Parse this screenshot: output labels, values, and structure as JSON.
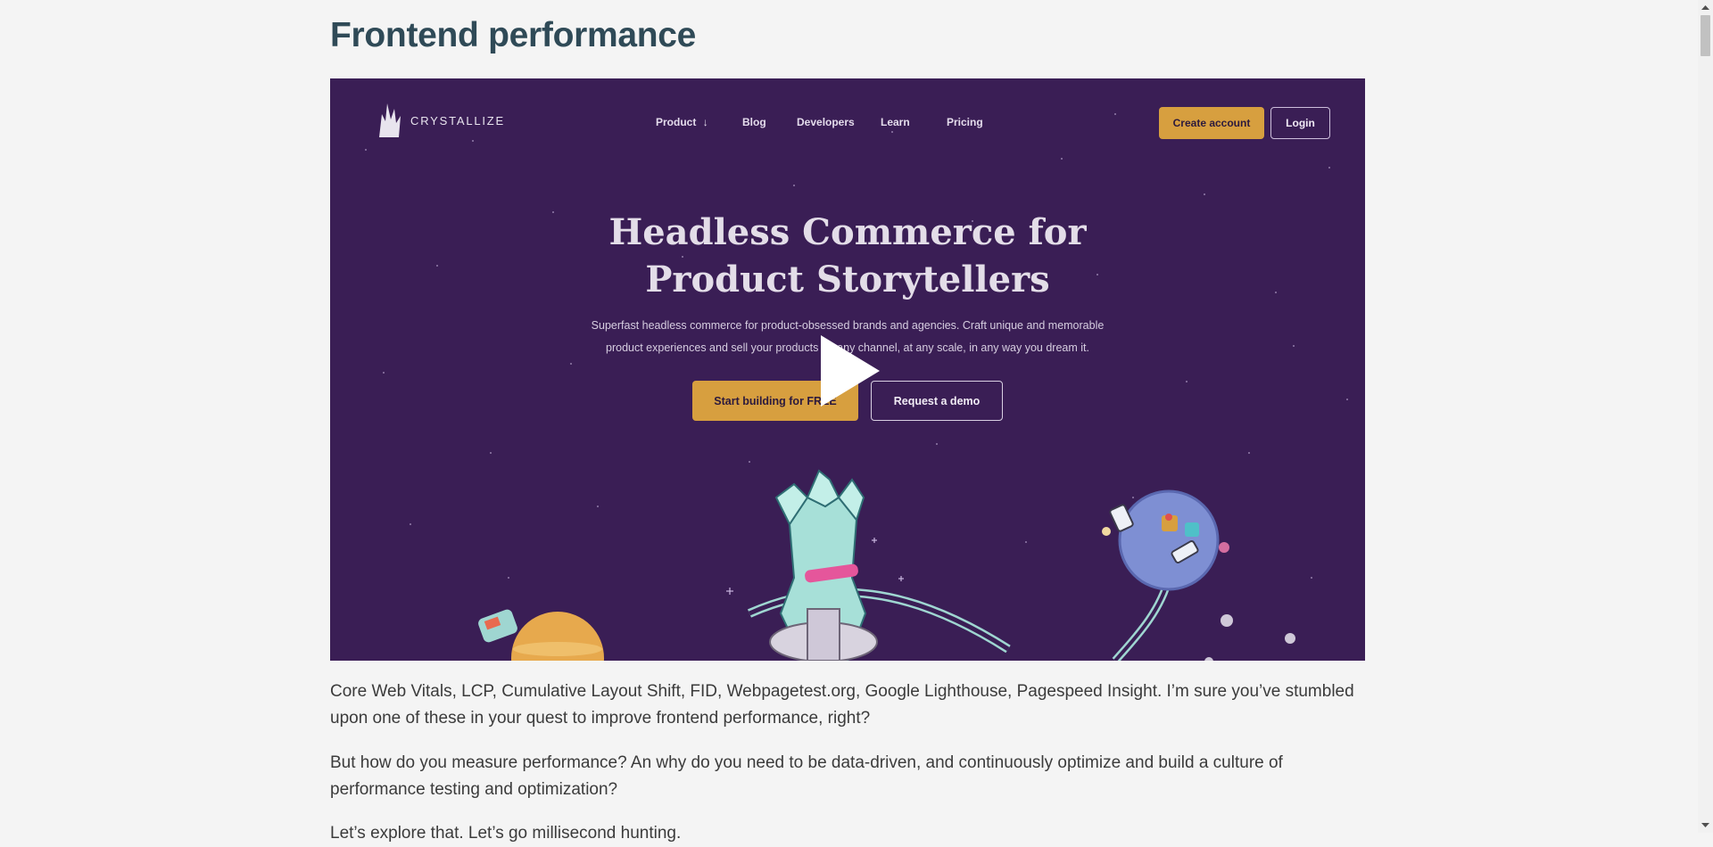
{
  "page": {
    "title": "Frontend performance"
  },
  "video": {
    "logo_text": "CRYSTALLIZE",
    "nav": [
      {
        "label": "Product",
        "has_dropdown": true
      },
      {
        "label": "Blog"
      },
      {
        "label": "Developers"
      },
      {
        "label": "Learn"
      },
      {
        "label": "Pricing"
      }
    ],
    "create_account": "Create account",
    "login": "Login",
    "headline_line1": "Headless Commerce for",
    "headline_line2": "Product Storytellers",
    "sub_line1": "Superfast headless commerce for product-obsessed brands and agencies. Craft unique and memorable",
    "sub_line2": "product experiences and sell your products on any channel, at any scale, in any way you dream it.",
    "cta_primary": "Start building for FREE",
    "cta_secondary": "Request a demo",
    "play_icon": "play-icon",
    "colors": {
      "background": "#3a1e55",
      "accent": "#d79f3f"
    }
  },
  "article": {
    "paragraphs": [
      "Core Web Vitals, LCP, Cumulative Layout Shift, FID, Webpagetest.org, Google Lighthouse, Pagespeed Insight. I’m sure you’ve stumbled upon one of these in your quest to improve frontend performance, right?",
      "But how do you measure performance? An why do you need to be data-driven, and continuously optimize and build a culture of performance testing and optimization?",
      "Let’s explore that. Let’s go millisecond hunting."
    ]
  },
  "colors": {
    "page_background": "#f4f4f4",
    "title": "#2f4a57",
    "body_text": "#3b3b3b"
  }
}
